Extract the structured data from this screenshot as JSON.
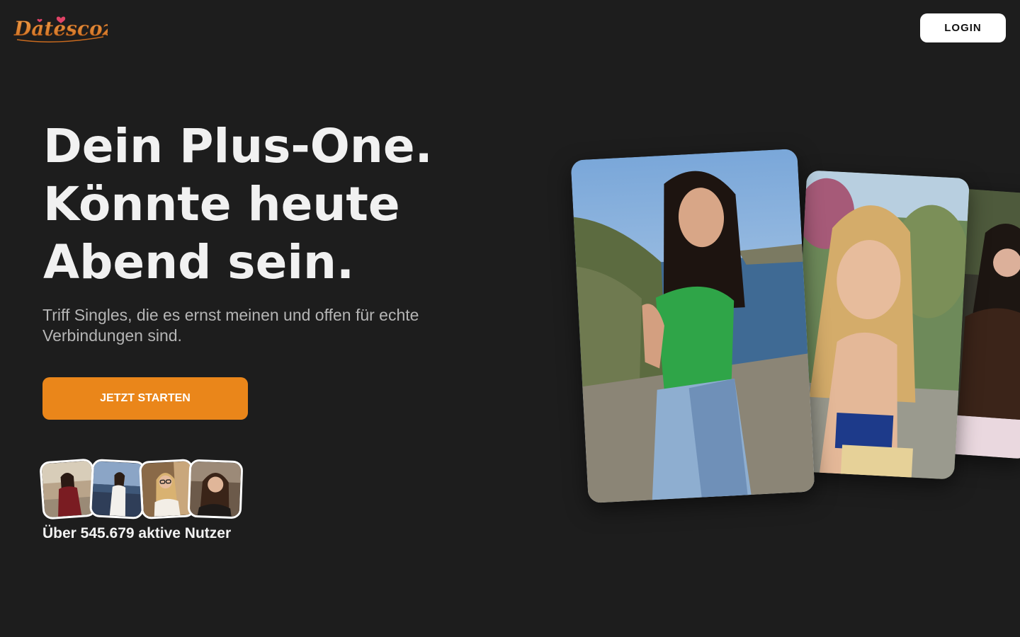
{
  "header": {
    "logo_text": "Datescozy",
    "login_label": "LOGIN"
  },
  "hero": {
    "headline_line1": "Dein Plus-One.",
    "headline_line2": "Könnte heute",
    "headline_line3": "Abend sein.",
    "subline": "Triff Singles, die es ernst meinen und offen für echte Verbindungen sind.",
    "cta_label": "JETZT STARTEN",
    "users_count_text": "Über 545.679 aktive Nutzer"
  },
  "colors": {
    "background": "#1d1d1d",
    "accent": "#ea861a",
    "logo": "#e8873a",
    "heart": "#e04367"
  },
  "icons": {
    "logo_heart": "heart-icon"
  }
}
